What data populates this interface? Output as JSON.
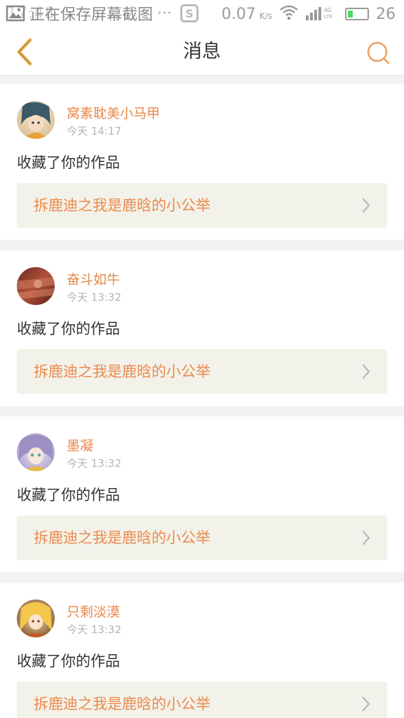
{
  "status_bar": {
    "time_ghost": "17:48",
    "saving_text": "正在保存屏幕截图",
    "dots": "···",
    "s_logo": "S",
    "net_speed": "0.07",
    "net_unit": "K/s",
    "network_label": "4G LTE",
    "battery_level": 26
  },
  "nav": {
    "title": "消息"
  },
  "messages": [
    {
      "username": "窝素耽美小马甲",
      "time": "今天 14:17",
      "action": "收藏了你的作品",
      "work_title": "拆鹿迪之我是鹿晗的小公举"
    },
    {
      "username": "奋斗如牛",
      "time": "今天 13:32",
      "action": "收藏了你的作品",
      "work_title": "拆鹿迪之我是鹿晗的小公举"
    },
    {
      "username": "墨凝",
      "time": "今天 13:32",
      "action": "收藏了你的作品",
      "work_title": "拆鹿迪之我是鹿晗的小公举"
    },
    {
      "username": "只剩淡漠",
      "time": "今天 13:32",
      "action": "收藏了你的作品",
      "work_title": "拆鹿迪之我是鹿晗的小公举"
    }
  ],
  "colors": {
    "accent": "#e8874a",
    "link_bg": "#f2f2ea",
    "background": "#f2f2f2"
  }
}
